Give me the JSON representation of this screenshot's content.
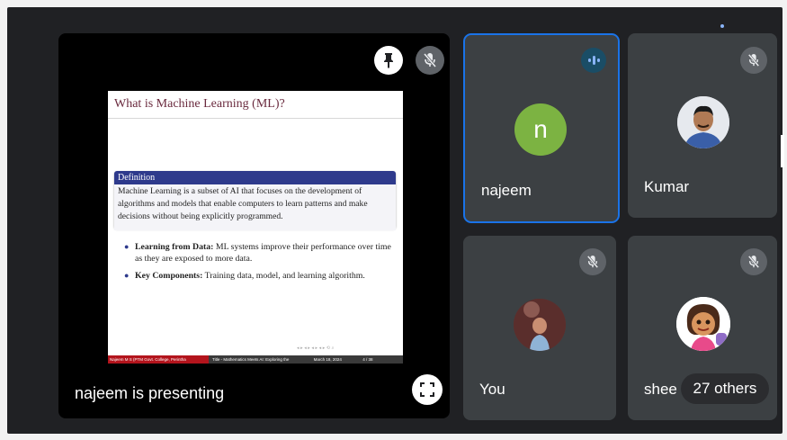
{
  "presenter": {
    "label": "najeem is presenting",
    "slide": {
      "title": "What is Machine Learning (ML)?",
      "definition_title": "Definition",
      "definition_text": "Machine Learning is a subset of AI that focuses on the development of algorithms and models that enable computers to learn patterns and make decisions without being explicitly programmed.",
      "bullets": [
        {
          "bold": "Learning from Data:",
          "text": "ML systems improve their performance over time as they are exposed to more data."
        },
        {
          "bold": "Key Components:",
          "text": "Training data, model, and learning algorithm."
        }
      ],
      "footer_left": "Najeem M S (PTM Govt. College, Perintha",
      "footer_mid": "Title - Mathematics Meets AI: Exploring the",
      "footer_date": "March 18, 2024",
      "footer_page": "4 / 38"
    }
  },
  "tiles": [
    {
      "name": "najeem",
      "initial": "n",
      "avatar_color": "#7cb342",
      "speaking": true
    },
    {
      "name": "Kumar",
      "muted": true
    },
    {
      "name": "You",
      "muted": true
    },
    {
      "name": "shee",
      "muted": true
    }
  ],
  "others": {
    "label": "27 others"
  },
  "colors": {
    "accent": "#8ab4f8",
    "tile_bg": "#3c4043",
    "speaking_border": "#1a73e8"
  }
}
